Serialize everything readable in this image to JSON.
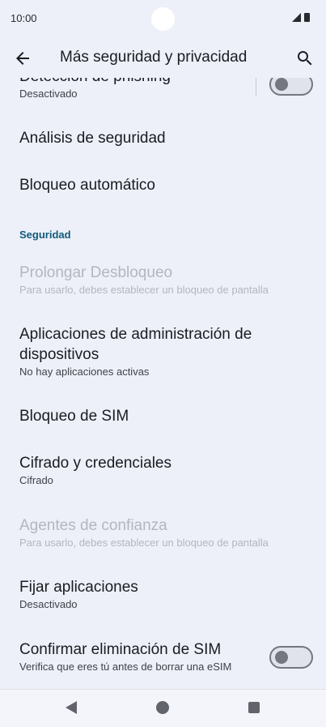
{
  "status_bar": {
    "time": "10:00"
  },
  "app_bar": {
    "title": "Más seguridad y privacidad"
  },
  "items": {
    "phishing": {
      "title": "Detección de phishing",
      "subtitle": "Desactivado",
      "enabled": false
    },
    "security_analysis": {
      "title": "Análisis de seguridad"
    },
    "auto_lock": {
      "title": "Bloqueo automático"
    },
    "section_security": "Seguridad",
    "extend_unlock": {
      "title": "Prolongar Desbloqueo",
      "subtitle": "Para usarlo, debes establecer un bloqueo de pantalla"
    },
    "device_admin": {
      "title_line1": "Aplicaciones de administración de",
      "title_line2": "dispositivos",
      "subtitle": "No hay aplicaciones activas"
    },
    "sim_lock": {
      "title": "Bloqueo de SIM"
    },
    "encryption": {
      "title": "Cifrado y credenciales",
      "subtitle": "Cifrado"
    },
    "trust_agents": {
      "title": "Agentes de confianza",
      "subtitle": "Para usarlo, debes establecer un bloqueo de pantalla"
    },
    "pin_apps": {
      "title": "Fijar aplicaciones",
      "subtitle": "Desactivado"
    },
    "confirm_sim_delete": {
      "title": "Confirmar eliminación de SIM",
      "subtitle": "Verifica que eres tú antes de borrar una eSIM",
      "enabled": false
    }
  },
  "colors": {
    "background": "#edf0f9",
    "accent": "#0f5b79",
    "disabled_text": "#b4b6bd"
  }
}
